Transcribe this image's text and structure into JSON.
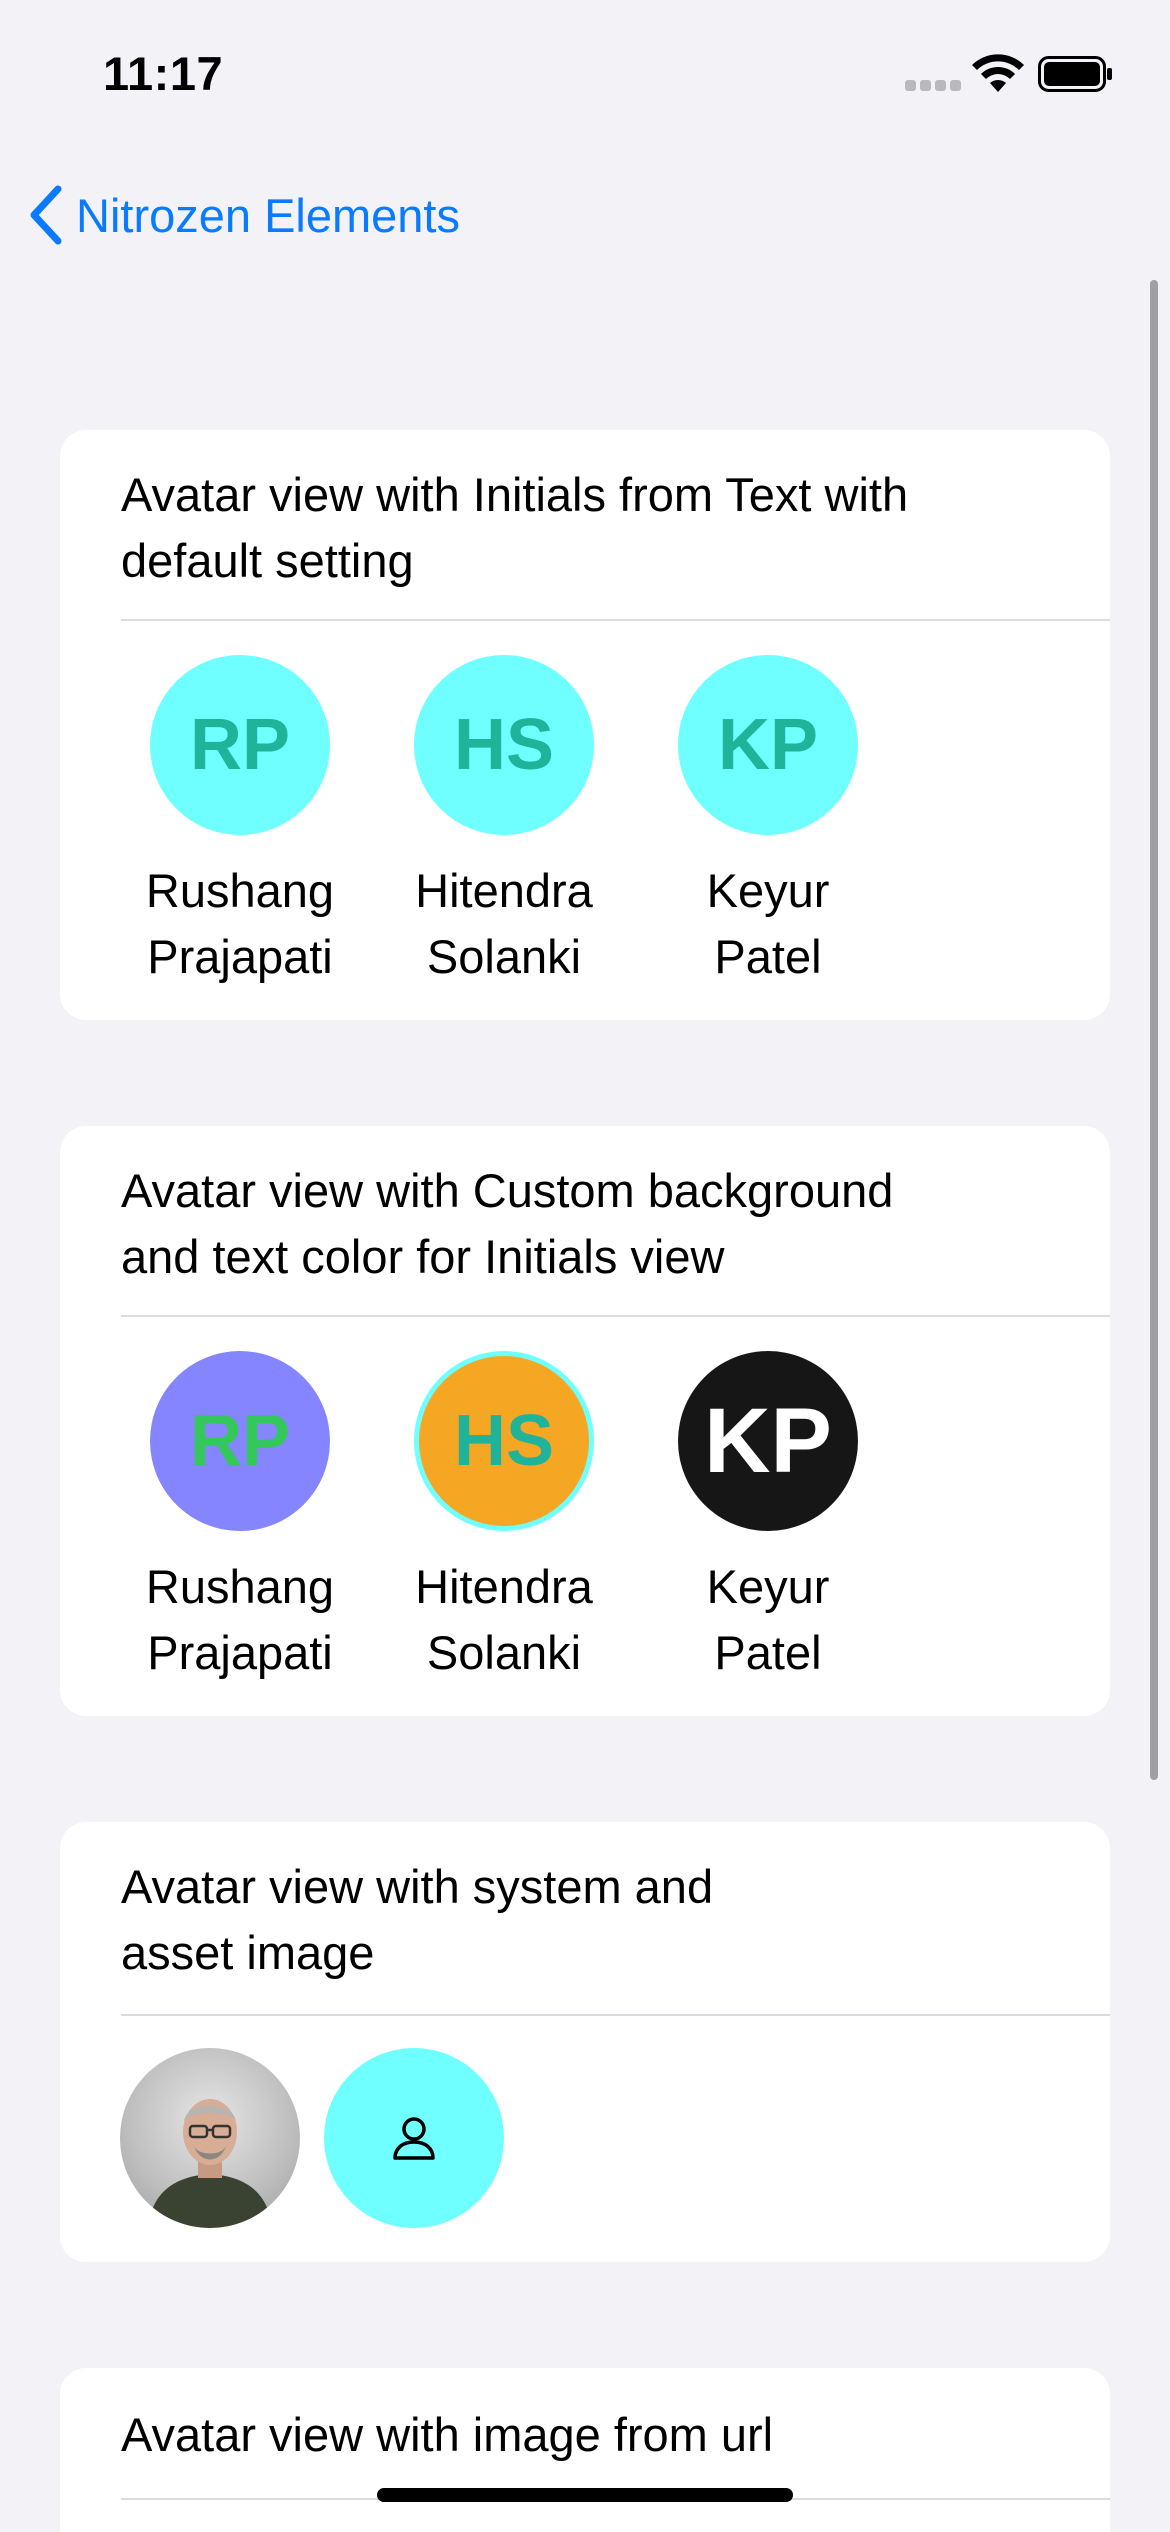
{
  "status_bar": {
    "time": "11:17"
  },
  "nav": {
    "back_label": "Nitrozen Elements"
  },
  "sections": [
    {
      "title_line1": "Avatar view with Initials from Text with",
      "title_line2": "default setting",
      "avatars": [
        {
          "initials": "RP",
          "name_line1": "Rushang",
          "name_line2": "Prajapati",
          "bg": "#6FFFFF",
          "fg": "#1FB39A"
        },
        {
          "initials": "HS",
          "name_line1": "Hitendra",
          "name_line2": "Solanki",
          "bg": "#6FFFFF",
          "fg": "#1FB39A"
        },
        {
          "initials": "KP",
          "name_line1": "Keyur",
          "name_line2": "Patel",
          "bg": "#6FFFFF",
          "fg": "#1FB39A"
        }
      ]
    },
    {
      "title_line1": "Avatar view with Custom background",
      "title_line2": "and text color for Initials view",
      "avatars": [
        {
          "initials": "RP",
          "name_line1": "Rushang",
          "name_line2": "Prajapati",
          "bg": "#8485FF",
          "fg": "#34C759"
        },
        {
          "initials": "HS",
          "name_line1": "Hitendra",
          "name_line2": "Solanki",
          "bg": "#F5A623",
          "fg": "#1FB39A",
          "border": "#6FFFFF"
        },
        {
          "initials": "KP",
          "name_line1": "Keyur",
          "name_line2": "Patel",
          "bg": "#161616",
          "fg": "#FFFFFF"
        }
      ]
    },
    {
      "title_line1": "Avatar view with system and",
      "title_line2": "asset image",
      "images": [
        {
          "icon": "person-photo"
        },
        {
          "icon": "person-icon",
          "bg": "#6FFFFF"
        }
      ]
    },
    {
      "title_line1": "Avatar view with image from url"
    }
  ],
  "colors": {
    "accent": "#0A7AFF",
    "background": "#F2F2F7",
    "card": "#FFFFFF"
  }
}
